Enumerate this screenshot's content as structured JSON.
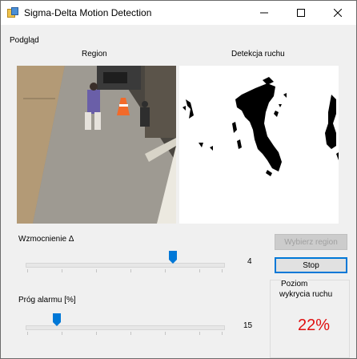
{
  "window": {
    "title": "Sigma-Delta Motion Detection"
  },
  "preview": {
    "group_label": "Podgląd",
    "region_label": "Region",
    "motion_label": "Detekcja ruchu"
  },
  "gain": {
    "label": "Wzmocnienie Δ",
    "value": "4",
    "slider_fraction": 0.7
  },
  "threshold": {
    "label": "Próg alarmu [%]",
    "value": "15",
    "slider_fraction": 0.15
  },
  "buttons": {
    "select_region": "Wybierz region",
    "stop": "Stop"
  },
  "detection": {
    "label_line1": "Poziom",
    "label_line2": "wykrycia ruchu",
    "value": "22%"
  },
  "colors": {
    "accent": "#0078d7",
    "alarm": "#e01010"
  }
}
